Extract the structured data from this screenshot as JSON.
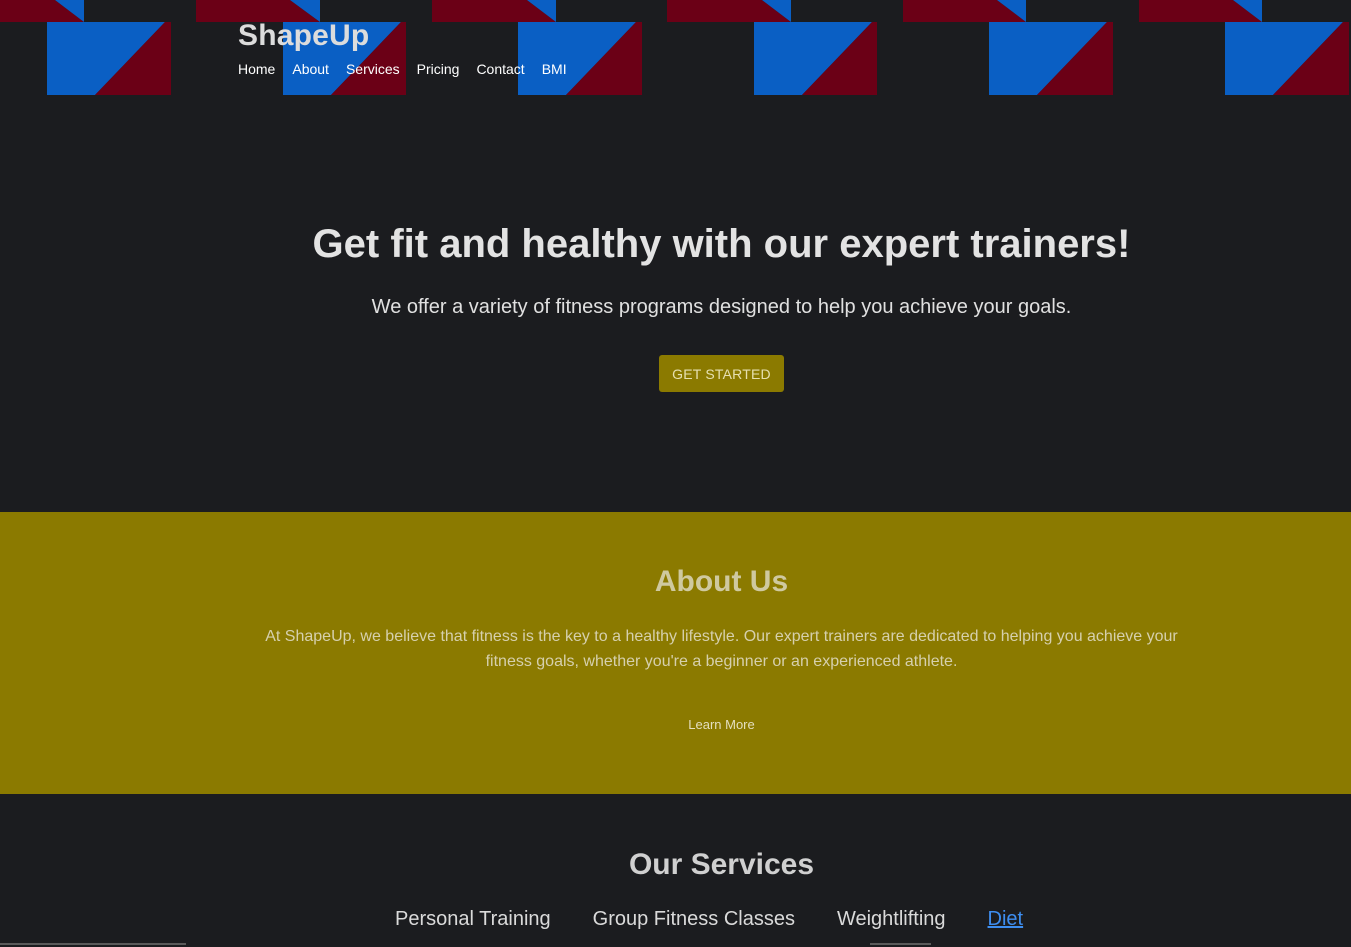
{
  "header": {
    "brand": "ShapeUp",
    "nav": [
      "Home",
      "About",
      "Services",
      "Pricing",
      "Contact",
      "BMI"
    ]
  },
  "hero": {
    "title": "Get fit and healthy with our expert trainers!",
    "subtitle": "We offer a variety of fitness programs designed to help you achieve your goals.",
    "cta_label": "GET STARTED"
  },
  "about": {
    "title": "About Us",
    "text_line1": "At ShapeUp, we believe that fitness is the key to a healthy lifestyle. Our expert trainers are dedicated to helping you achieve your",
    "text_line2": "fitness goals, whether you're a beginner or an experienced athlete.",
    "link_label": "Learn More"
  },
  "services": {
    "title": "Our Services",
    "items": [
      "Personal Training",
      "Group Fitness Classes",
      "Weightlifting"
    ],
    "link_item": "Diet"
  },
  "colors": {
    "background": "#1b1c1f",
    "accent_olive": "#8b7a00",
    "pattern_blue": "#0a5fc4",
    "pattern_red": "#6b0016",
    "link_blue": "#3e8ef0"
  }
}
